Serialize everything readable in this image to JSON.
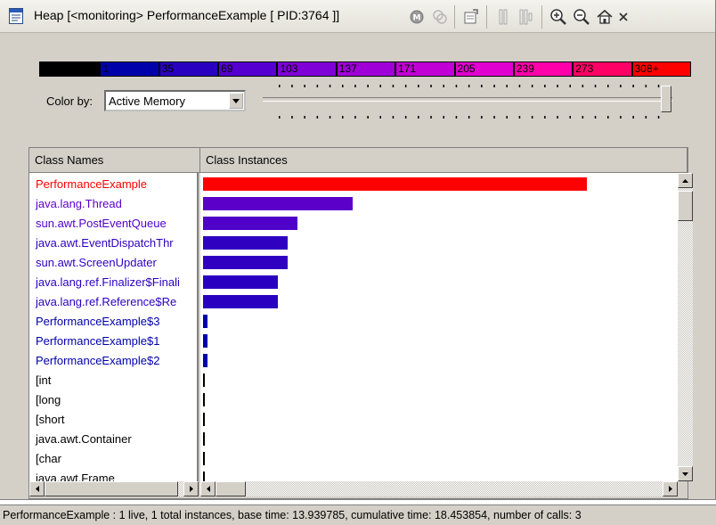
{
  "window": {
    "title": "Heap [<monitoring> PerformanceExample [ PID:3764 ]]",
    "toolbar_icons": [
      "monitor-m-icon",
      "cycle-icon",
      "export-icon",
      "column-icon",
      "column-split-icon",
      "zoom-in-icon",
      "zoom-out-icon",
      "home-icon",
      "close-icon"
    ]
  },
  "legend": {
    "segments": [
      {
        "label": "0",
        "color": "#000000"
      },
      {
        "label": "1",
        "color": "#0000aa"
      },
      {
        "label": "35",
        "color": "#2a00c0"
      },
      {
        "label": "69",
        "color": "#5500d0"
      },
      {
        "label": "103",
        "color": "#8000d8"
      },
      {
        "label": "137",
        "color": "#a000d8"
      },
      {
        "label": "171",
        "color": "#c000d4"
      },
      {
        "label": "205",
        "color": "#e000d0"
      },
      {
        "label": "239",
        "color": "#ff00aa"
      },
      {
        "label": "273",
        "color": "#ff0066"
      },
      {
        "label": "308+",
        "color": "#ff0000"
      }
    ]
  },
  "controls": {
    "color_by_label": "Color by:",
    "color_by_value": "Active Memory",
    "slider_fraction": 1.0
  },
  "table": {
    "col_names_header": "Class Names",
    "col_instances_header": "Class Instances",
    "max_value": 1,
    "rows": [
      {
        "name": "PerformanceExample",
        "value": 1.0,
        "color": "#ff0000"
      },
      {
        "name": "java.lang.Thread",
        "value": 0.39,
        "color": "#5a00c8"
      },
      {
        "name": "sun.awt.PostEventQueue",
        "value": 0.245,
        "color": "#4e00c8"
      },
      {
        "name": "java.awt.EventDispatchThr",
        "value": 0.22,
        "color": "#3000c0"
      },
      {
        "name": "sun.awt.ScreenUpdater",
        "value": 0.22,
        "color": "#3000c0"
      },
      {
        "name": "java.lang.ref.Finalizer$Finali",
        "value": 0.195,
        "color": "#2a00c0"
      },
      {
        "name": "java.lang.ref.Reference$Re",
        "value": 0.195,
        "color": "#2a00c0"
      },
      {
        "name": "PerformanceExample$3",
        "value": 0.012,
        "color": "#0000aa"
      },
      {
        "name": "PerformanceExample$1",
        "value": 0.012,
        "color": "#0000aa"
      },
      {
        "name": "PerformanceExample$2",
        "value": 0.012,
        "color": "#0000aa"
      },
      {
        "name": "[int",
        "value": 0.004,
        "color": "#000000"
      },
      {
        "name": "[long",
        "value": 0.004,
        "color": "#000000"
      },
      {
        "name": "[short",
        "value": 0.004,
        "color": "#000000"
      },
      {
        "name": "java.awt.Container",
        "value": 0.004,
        "color": "#000000"
      },
      {
        "name": "[char",
        "value": 0.004,
        "color": "#000000"
      },
      {
        "name": "java.awt.Frame",
        "value": 0.004,
        "color": "#000000"
      }
    ]
  },
  "status": {
    "text": "PerformanceExample : 1 live, 1 total instances, base time: 13.939785, cumulative time: 18.453854, number of calls: 3"
  }
}
